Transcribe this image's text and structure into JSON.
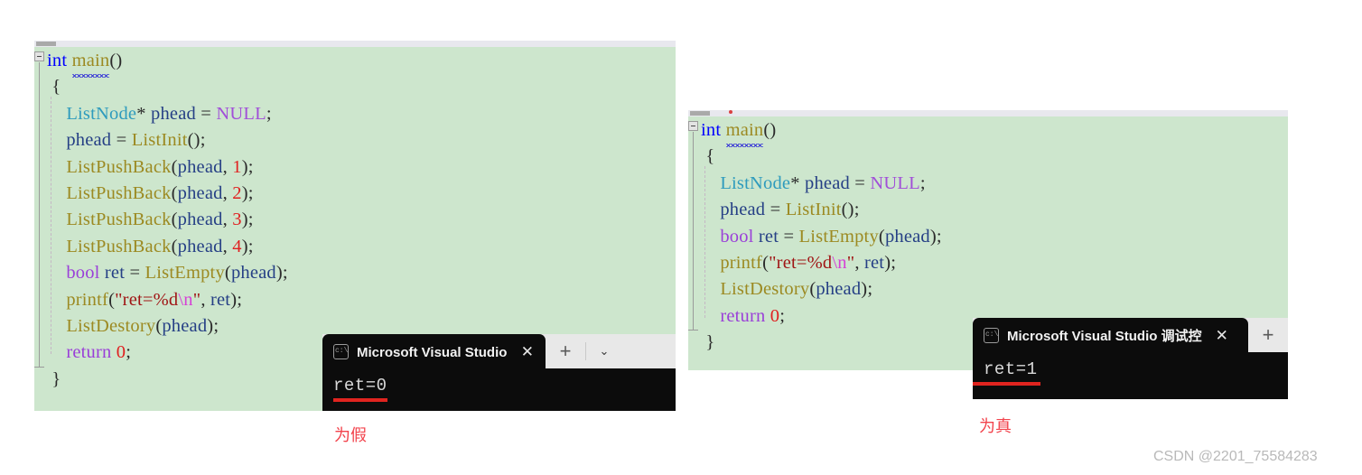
{
  "watermark": "CSDN @2201_75584283",
  "left_panel": {
    "name": "left-code-editor",
    "code_lines": [
      [
        {
          "t": "int ",
          "c": "kw"
        },
        {
          "t": "main",
          "c": "fn squiggle"
        },
        {
          "t": "()",
          "c": "punct"
        }
      ],
      [
        {
          "t": "{",
          "c": "brace"
        }
      ],
      [
        {
          "t": "ListNode",
          "c": "type"
        },
        {
          "t": "* ",
          "c": "punct"
        },
        {
          "t": "phead",
          "c": "var"
        },
        {
          "t": " = ",
          "c": "punct"
        },
        {
          "t": "NULL",
          "c": "macro"
        },
        {
          "t": ";",
          "c": "punct"
        }
      ],
      [
        {
          "t": "phead",
          "c": "var"
        },
        {
          "t": " = ",
          "c": "punct"
        },
        {
          "t": "ListInit",
          "c": "fn"
        },
        {
          "t": "();",
          "c": "punct"
        }
      ],
      [
        {
          "t": "ListPushBack",
          "c": "fn"
        },
        {
          "t": "(",
          "c": "punct"
        },
        {
          "t": "phead",
          "c": "var"
        },
        {
          "t": ", ",
          "c": "punct"
        },
        {
          "t": "1",
          "c": "num"
        },
        {
          "t": ");",
          "c": "punct"
        }
      ],
      [
        {
          "t": "ListPushBack",
          "c": "fn"
        },
        {
          "t": "(",
          "c": "punct"
        },
        {
          "t": "phead",
          "c": "var"
        },
        {
          "t": ", ",
          "c": "punct"
        },
        {
          "t": "2",
          "c": "num"
        },
        {
          "t": ");",
          "c": "punct"
        }
      ],
      [
        {
          "t": "ListPushBack",
          "c": "fn"
        },
        {
          "t": "(",
          "c": "punct"
        },
        {
          "t": "phead",
          "c": "var"
        },
        {
          "t": ", ",
          "c": "punct"
        },
        {
          "t": "3",
          "c": "num"
        },
        {
          "t": ");",
          "c": "punct"
        }
      ],
      [
        {
          "t": "ListPushBack",
          "c": "fn"
        },
        {
          "t": "(",
          "c": "punct"
        },
        {
          "t": "phead",
          "c": "var"
        },
        {
          "t": ", ",
          "c": "punct"
        },
        {
          "t": "4",
          "c": "num"
        },
        {
          "t": ");",
          "c": "punct"
        }
      ],
      [
        {
          "t": "bool",
          "c": "kw2"
        },
        {
          "t": " ",
          "c": "punct"
        },
        {
          "t": "ret",
          "c": "var"
        },
        {
          "t": " = ",
          "c": "punct"
        },
        {
          "t": "ListEmpty",
          "c": "fn"
        },
        {
          "t": "(",
          "c": "punct"
        },
        {
          "t": "phead",
          "c": "var"
        },
        {
          "t": ");",
          "c": "punct"
        }
      ],
      [
        {
          "t": "printf",
          "c": "fn"
        },
        {
          "t": "(",
          "c": "punct"
        },
        {
          "t": "\"ret=%d",
          "c": "str"
        },
        {
          "t": "\\n",
          "c": "esc"
        },
        {
          "t": "\"",
          "c": "str"
        },
        {
          "t": ", ",
          "c": "punct"
        },
        {
          "t": "ret",
          "c": "var"
        },
        {
          "t": ");",
          "c": "punct"
        }
      ],
      [
        {
          "t": "ListDestory",
          "c": "fn"
        },
        {
          "t": "(",
          "c": "punct"
        },
        {
          "t": "phead",
          "c": "var"
        },
        {
          "t": ");",
          "c": "punct"
        }
      ],
      [
        {
          "t": "return",
          "c": "kw2"
        },
        {
          "t": " ",
          "c": "punct"
        },
        {
          "t": "0",
          "c": "num"
        },
        {
          "t": ";",
          "c": "punct"
        }
      ],
      [
        {
          "t": "}",
          "c": "brace"
        }
      ]
    ],
    "console": {
      "tab_title": "Microsoft Visual Studio 调试控",
      "close_icon": "✕",
      "new_tab_icon": "+",
      "chevron_icon": "⌄",
      "output": "ret=0"
    },
    "annotation": "为假"
  },
  "right_panel": {
    "name": "right-code-editor",
    "code_lines": [
      [
        {
          "t": "int ",
          "c": "kw"
        },
        {
          "t": "main",
          "c": "fn squiggle"
        },
        {
          "t": "()",
          "c": "punct"
        }
      ],
      [
        {
          "t": "{",
          "c": "brace"
        }
      ],
      [
        {
          "t": "ListNode",
          "c": "type"
        },
        {
          "t": "* ",
          "c": "punct"
        },
        {
          "t": "phead",
          "c": "var"
        },
        {
          "t": " = ",
          "c": "punct"
        },
        {
          "t": "NULL",
          "c": "macro"
        },
        {
          "t": ";",
          "c": "punct"
        }
      ],
      [
        {
          "t": "phead",
          "c": "var"
        },
        {
          "t": " = ",
          "c": "punct"
        },
        {
          "t": "ListInit",
          "c": "fn"
        },
        {
          "t": "();",
          "c": "punct"
        }
      ],
      [
        {
          "t": "bool",
          "c": "kw2"
        },
        {
          "t": " ",
          "c": "punct"
        },
        {
          "t": "ret",
          "c": "var"
        },
        {
          "t": " = ",
          "c": "punct"
        },
        {
          "t": "ListEmpty",
          "c": "fn"
        },
        {
          "t": "(",
          "c": "punct"
        },
        {
          "t": "phead",
          "c": "var"
        },
        {
          "t": ");",
          "c": "punct"
        }
      ],
      [
        {
          "t": "printf",
          "c": "fn"
        },
        {
          "t": "(",
          "c": "punct"
        },
        {
          "t": "\"ret=%d",
          "c": "str"
        },
        {
          "t": "\\n",
          "c": "esc"
        },
        {
          "t": "\"",
          "c": "str"
        },
        {
          "t": ", ",
          "c": "punct"
        },
        {
          "t": "ret",
          "c": "var"
        },
        {
          "t": ");",
          "c": "punct"
        }
      ],
      [
        {
          "t": "ListDestory",
          "c": "fn"
        },
        {
          "t": "(",
          "c": "punct"
        },
        {
          "t": "phead",
          "c": "var"
        },
        {
          "t": ");",
          "c": "punct"
        }
      ],
      [
        {
          "t": "return",
          "c": "kw2"
        },
        {
          "t": " ",
          "c": "punct"
        },
        {
          "t": "0",
          "c": "num"
        },
        {
          "t": ";",
          "c": "punct"
        }
      ],
      [
        {
          "t": "}",
          "c": "brace"
        }
      ]
    ],
    "console": {
      "tab_title": "Microsoft Visual Studio 调试控",
      "close_icon": "✕",
      "new_tab_icon": "+",
      "output": "ret=1"
    },
    "annotation": "为真"
  },
  "colors": {
    "editor_background": "#cde6cd",
    "console_background": "#0c0c0c",
    "tabstrip_background": "#e8e8e8",
    "annotation_red": "#f2434c",
    "underline_red": "#e0241f",
    "watermark_gray": "#b9b9b9"
  }
}
